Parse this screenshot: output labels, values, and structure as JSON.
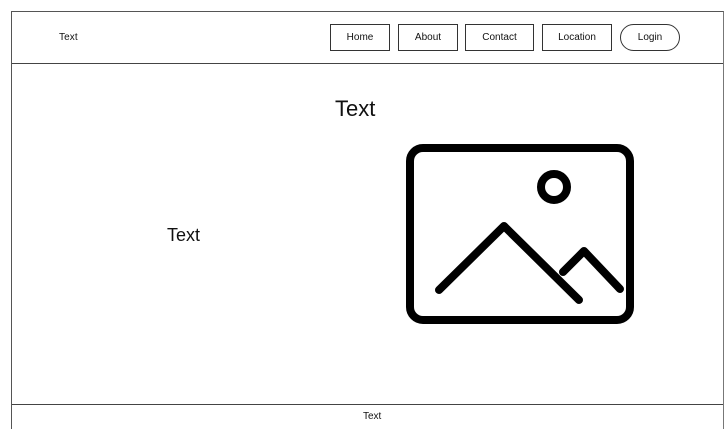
{
  "header": {
    "brand": "Text",
    "nav": {
      "home": "Home",
      "about": "About",
      "contact": "Contact",
      "location": "Location",
      "login": "Login"
    }
  },
  "main": {
    "title": "Text",
    "left_text": "Text",
    "image_icon": "image-placeholder-icon"
  },
  "footer": {
    "text": "Text"
  }
}
